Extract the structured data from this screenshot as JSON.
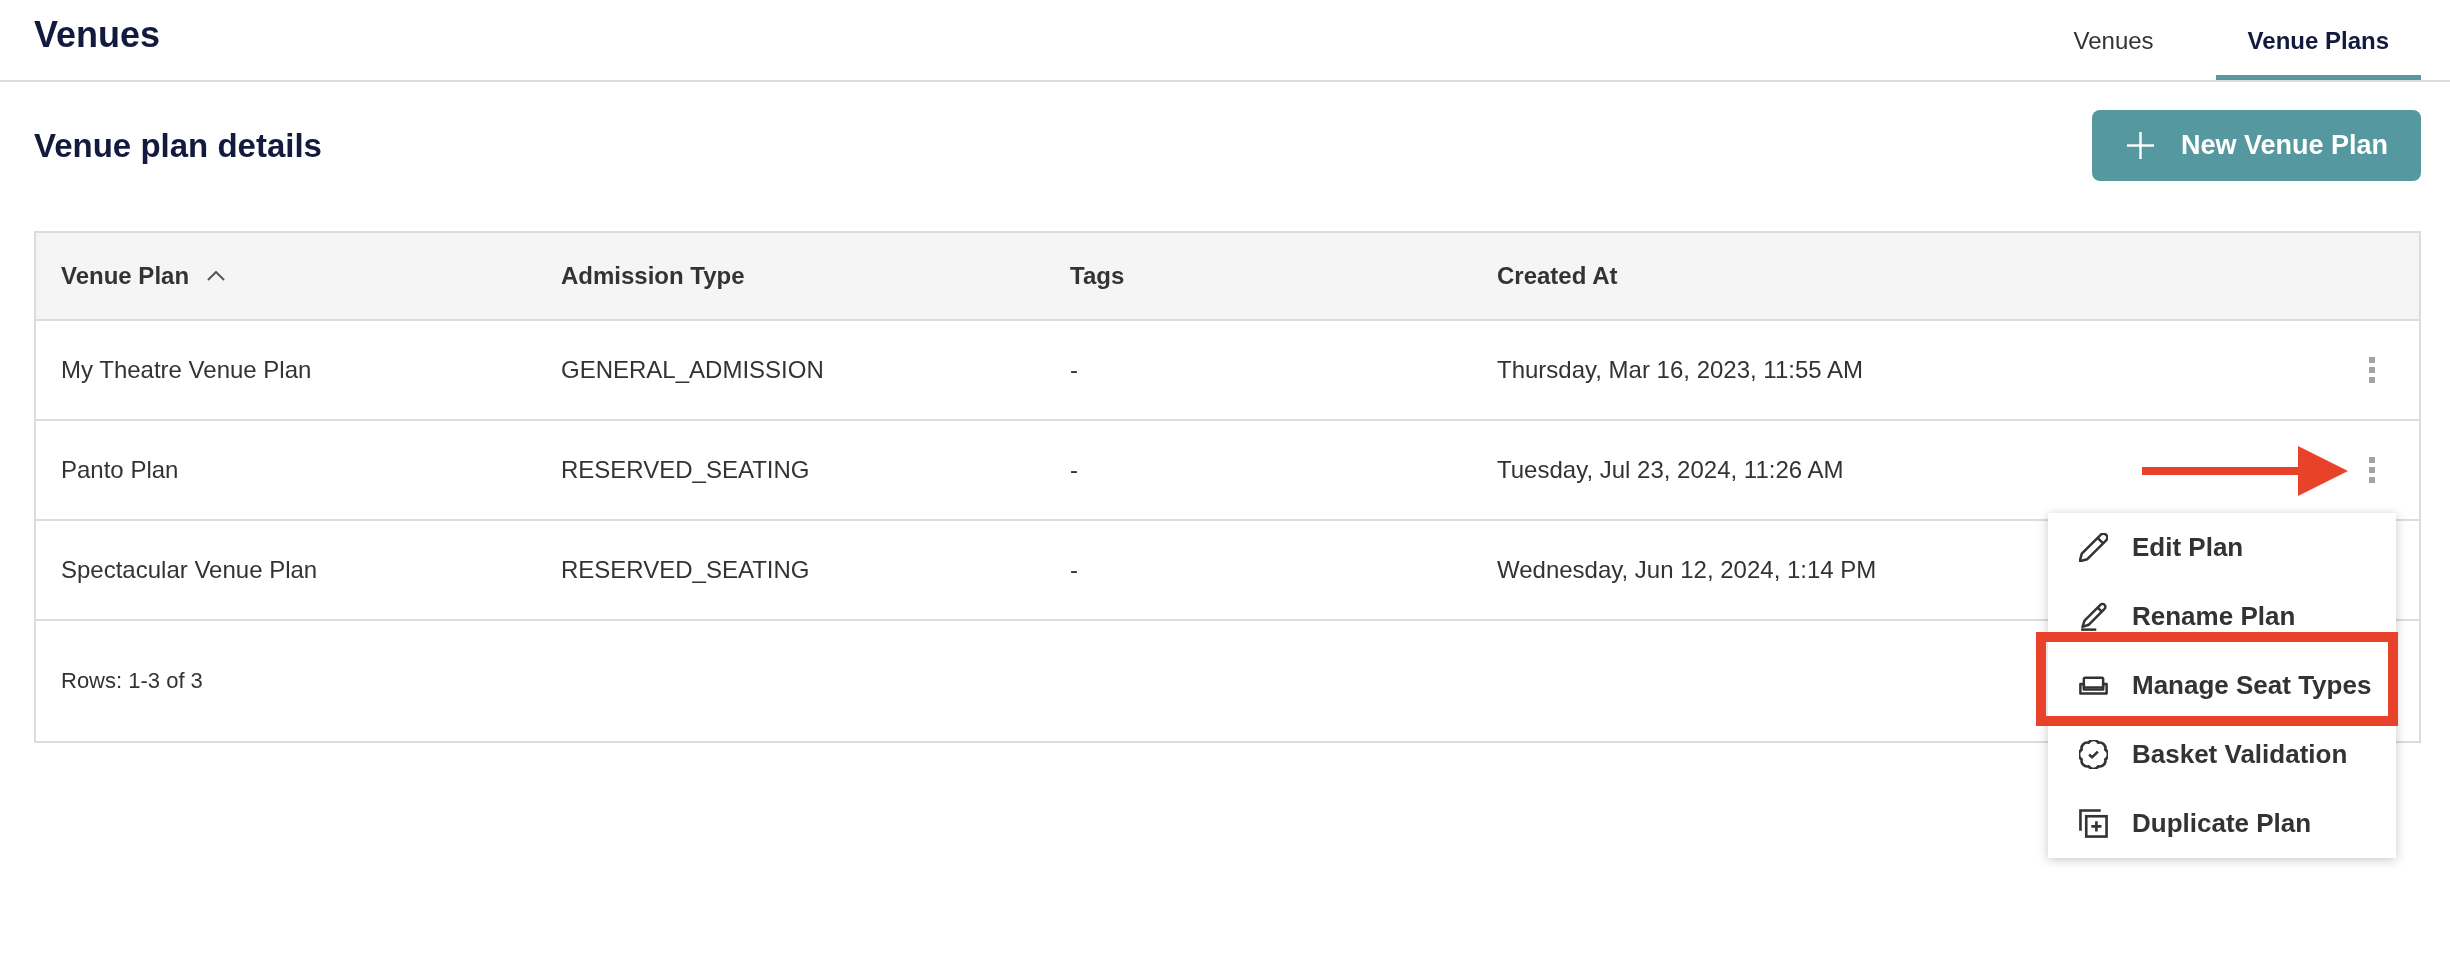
{
  "header": {
    "title": "Venues",
    "tabs": [
      {
        "label": "Venues",
        "selected": false
      },
      {
        "label": "Venue Plans",
        "selected": true
      }
    ]
  },
  "section": {
    "title": "Venue plan details",
    "new_button": {
      "label": "New Venue Plan"
    }
  },
  "table": {
    "columns": [
      {
        "label": "Venue Plan",
        "sorted": true
      },
      {
        "label": "Admission Type",
        "sorted": false
      },
      {
        "label": "Tags",
        "sorted": false
      },
      {
        "label": "Created At",
        "sorted": false
      }
    ],
    "rows": [
      {
        "cells": [
          "My Theatre Venue Plan",
          "GENERAL_ADMISSION",
          "-",
          "Thursday, Mar 16, 2023, 11:55 AM"
        ],
        "menu_open": false,
        "arrow": false
      },
      {
        "cells": [
          "Panto Plan",
          "RESERVED_SEATING",
          "-",
          "Tuesday, Jul 23, 2024, 11:26 AM"
        ],
        "menu_open": true,
        "arrow": true
      },
      {
        "cells": [
          "Spectacular Venue Plan",
          "RESERVED_SEATING",
          "-",
          "Wednesday, Jun 12, 2024, 1:14 PM"
        ],
        "menu_open": false,
        "arrow": false
      }
    ],
    "footer": "Rows: 1-3 of 3"
  },
  "menu": {
    "items": [
      {
        "label": "Edit Plan",
        "kind": "edit",
        "highlighted": false
      },
      {
        "label": "Rename Plan",
        "kind": "rename",
        "highlighted": false
      },
      {
        "label": "Manage Seat Types",
        "kind": "seats",
        "highlighted": true
      },
      {
        "label": "Basket Validation",
        "kind": "validation",
        "highlighted": false
      },
      {
        "label": "Duplicate Plan",
        "kind": "duplicate",
        "highlighted": false
      }
    ]
  }
}
